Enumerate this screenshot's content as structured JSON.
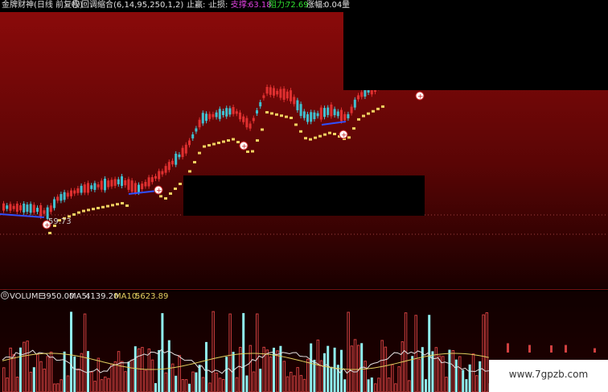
{
  "title_bar": {
    "stock_name": "金牌财神(日线 前复权)",
    "indicator_label": "回调缩合(6,14,95,250,1,2)",
    "stop_win": "止赢: ·",
    "stop_loss": "止损: ·",
    "support_label": "支撑:",
    "support_value": "63.18",
    "resistance_label": "阻力:",
    "resistance_value": "72.69",
    "change_label": "涨幅:",
    "change_value": "0.04",
    "change_tail": "量"
  },
  "main_chart": {
    "low_price_label": "59.73",
    "colors": {
      "bg_top": "#8a0a0a",
      "bg_bottom": "#1a0000",
      "up_candle": "#e03030",
      "down_candle": "#40c0d0",
      "support_dots": "#f0d060",
      "blue_line": "#3050ff"
    }
  },
  "volume_panel": {
    "volume_label": "VOLUME:",
    "volume_value": "3950.00",
    "ma5_label": "MA5:",
    "ma5_value": "4139.20",
    "ma10_label": "MA10:",
    "ma10_value": "5623.89"
  },
  "watermark": "www.7gpzb.com"
}
